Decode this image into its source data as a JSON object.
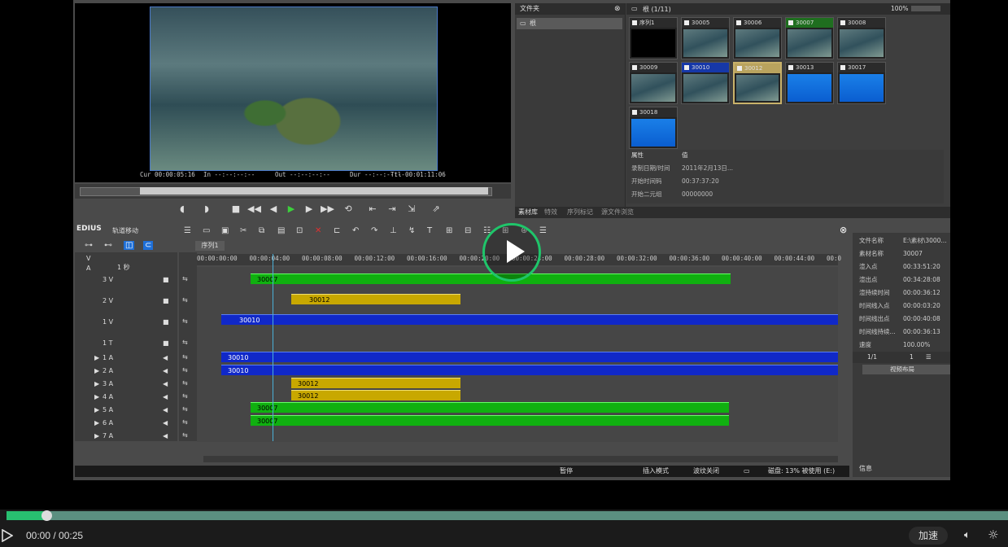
{
  "preview": {
    "tc_cur": "Cur 00:00:05:16",
    "tc_in": "In --:--:--:--",
    "tc_out": "Out --:--:--:--",
    "tc_dur": "Dur --:--:--:--",
    "tc_ttl": "Ttl 00:01:11:06"
  },
  "bin": {
    "folder_header": "文件夹",
    "folder_root": "根",
    "bin_path": "根 (1/11)",
    "zoom": "100%",
    "clips": [
      "序列1",
      "30005",
      "30006",
      "30007",
      "30008",
      "30009",
      "30010",
      "30012",
      "30013",
      "30017",
      "30018"
    ],
    "props_header_key": "属性",
    "props_header_val": "值",
    "props": [
      {
        "k": "录制日期/时间",
        "v": "2011年2月13日..."
      },
      {
        "k": "开始时间码",
        "v": "00:37:37:20"
      },
      {
        "k": "开始二元组",
        "v": "00000000"
      }
    ],
    "tabs": [
      "素材库",
      "特效",
      "序列标记",
      "源文件浏览"
    ]
  },
  "timeline": {
    "title": "EDIUS",
    "mode": "轨道移动",
    "sequence_tab": "序列1",
    "scale": "1 秒",
    "ruler": [
      "00:00:00:00",
      "00:00:04:00",
      "00:00:08:00",
      "00:00:12:00",
      "00:00:16:00",
      "00:00:20:00",
      "00:00:24:00",
      "00:00:28:00",
      "00:00:32:00",
      "00:00:36:00",
      "00:00:40:00",
      "00:00:44:00",
      "00:0"
    ],
    "tracks": [
      "V",
      "A",
      "3 V",
      "2 V",
      "1 V",
      "1 T",
      "1 A",
      "2 A",
      "3 A",
      "4 A",
      "5 A",
      "6 A",
      "7 A"
    ],
    "clips": {
      "v3": "30007",
      "v2": "30012",
      "v1": "30010",
      "a1": "30010",
      "a2": "30010",
      "a3": "30012",
      "a4": "30012",
      "a5": "30007",
      "a6": "30007"
    },
    "status": {
      "state": "暂停",
      "insert": "插入模式",
      "ripple": "波纹关闭",
      "disk": "磁盘: 13% 被使用 (E:)"
    }
  },
  "info": {
    "rows": [
      {
        "k": "文件名称",
        "v": "E:\\素材\\3000..."
      },
      {
        "k": "素材名称",
        "v": "30007"
      },
      {
        "k": "渲入点",
        "v": "00:33:51:20"
      },
      {
        "k": "渲出点",
        "v": "00:34:28:08"
      },
      {
        "k": "渲持续时间",
        "v": "00:00:36:12"
      },
      {
        "k": "时间线入点",
        "v": "00:00:03:20"
      },
      {
        "k": "时间线出点",
        "v": "00:00:40:08"
      },
      {
        "k": "时间线持续...",
        "v": "00:00:36:13"
      },
      {
        "k": "速度",
        "v": "100.00%"
      }
    ],
    "layer_count": "1/1",
    "layer_count2": "1",
    "effect": "视频布局",
    "footer": "信息"
  },
  "player": {
    "time": "00:00 / 00:25",
    "speed": "加速",
    "progress": 0.04
  }
}
